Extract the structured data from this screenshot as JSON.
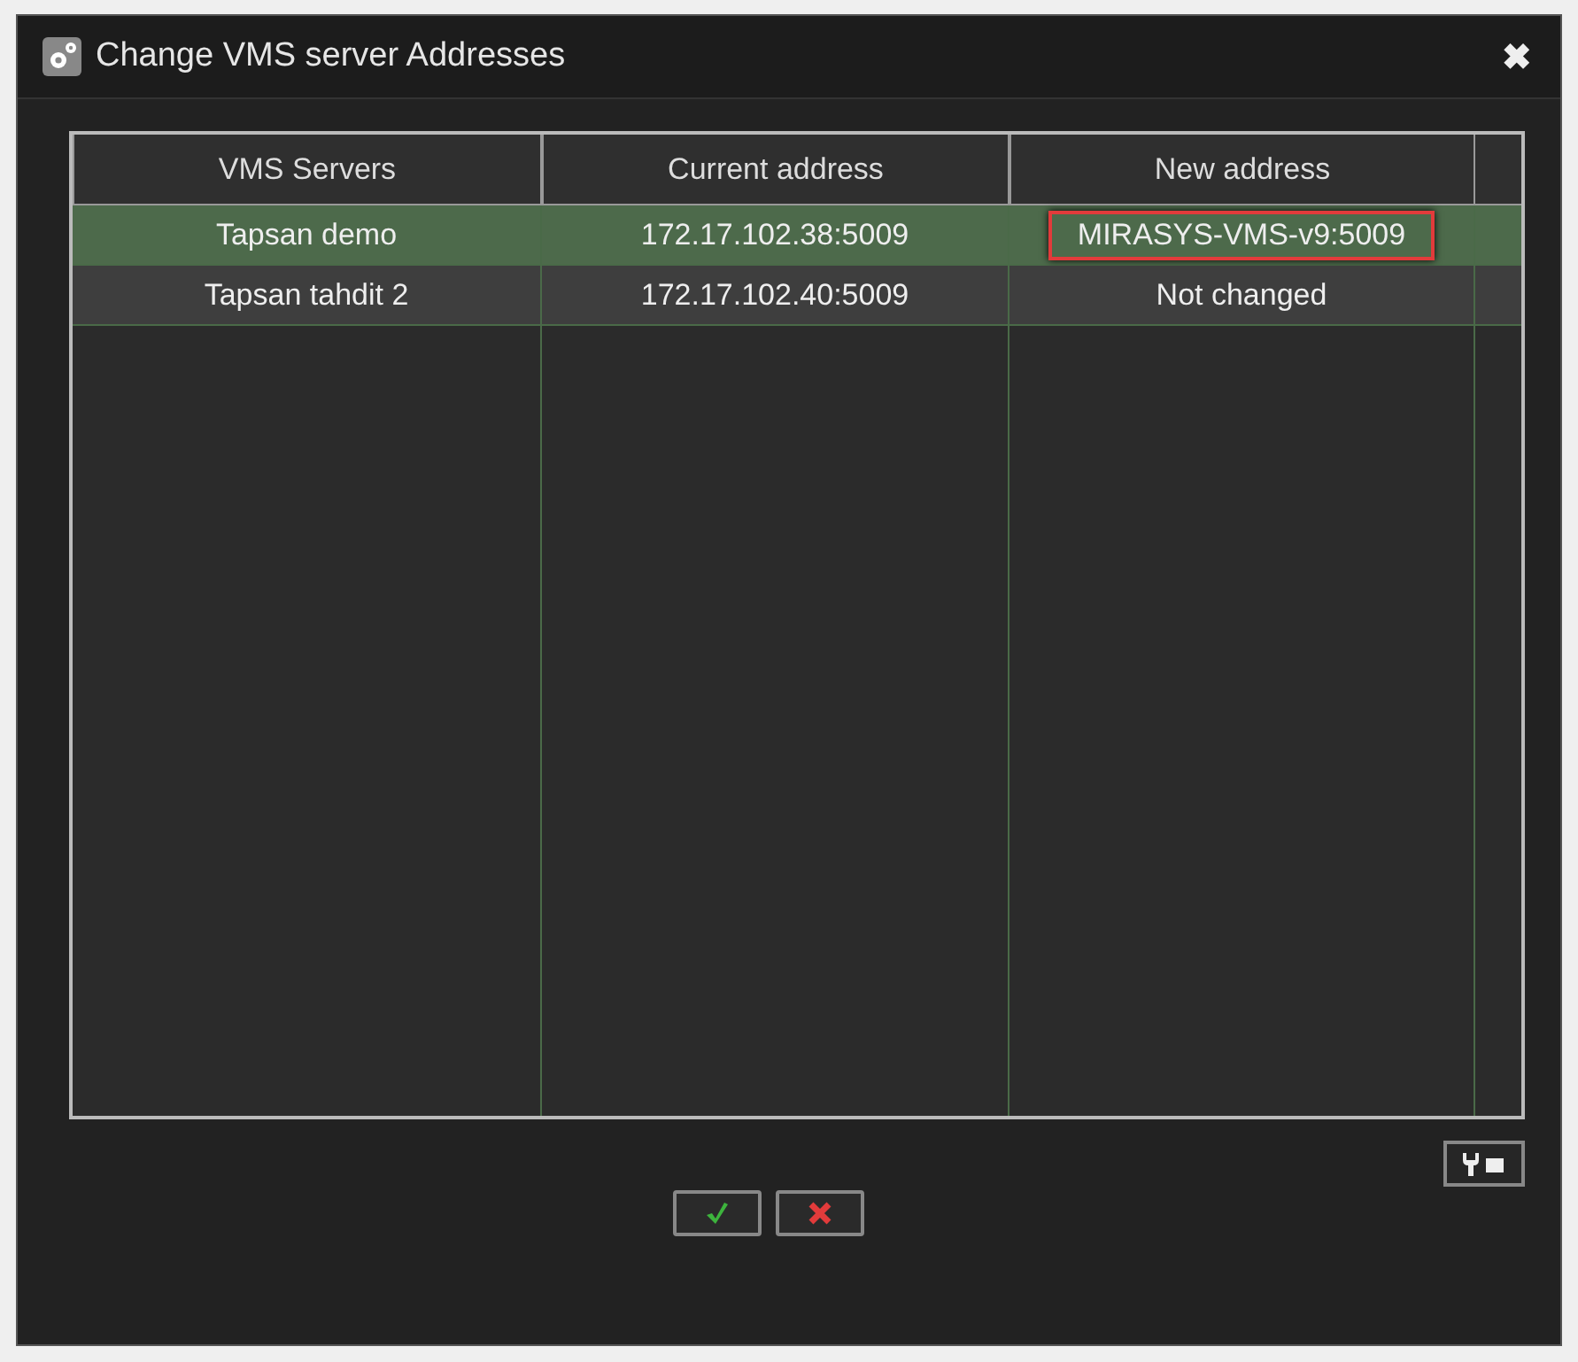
{
  "window": {
    "title": "Change VMS server Addresses",
    "close": "✖"
  },
  "table": {
    "columns": [
      "VMS Servers",
      "Current address",
      "New address"
    ],
    "rows": [
      {
        "selected": true,
        "cells": [
          {
            "text": "Tapsan demo",
            "highlighted": false
          },
          {
            "text": "172.17.102.38:5009",
            "highlighted": false
          },
          {
            "text": "MIRASYS-VMS-v9:5009",
            "highlighted": true
          }
        ]
      },
      {
        "selected": false,
        "cells": [
          {
            "text": "Tapsan tahdit 2",
            "highlighted": false
          },
          {
            "text": "172.17.102.40:5009",
            "highlighted": false
          },
          {
            "text": "Not changed",
            "highlighted": false
          }
        ]
      }
    ]
  },
  "buttons": [
    {
      "kind": "ok"
    },
    {
      "kind": "cancel"
    }
  ]
}
